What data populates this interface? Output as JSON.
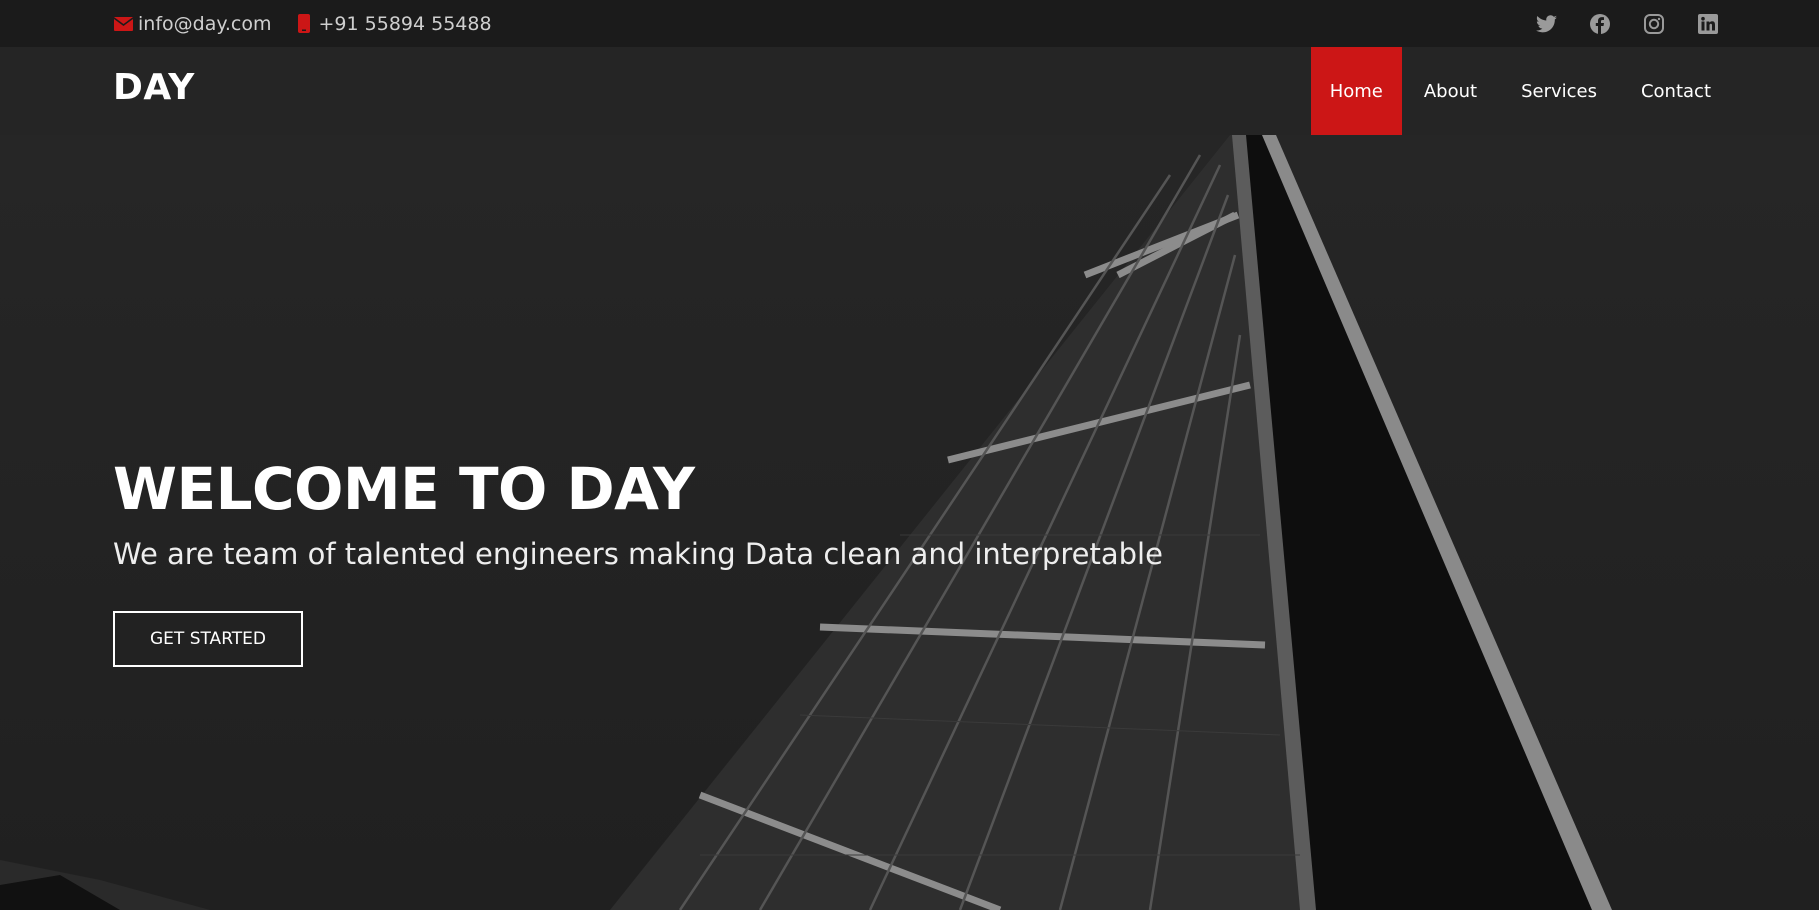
{
  "topbar": {
    "email": "info@day.com",
    "phone": "+91 55894 55488",
    "icons": {
      "email": "envelope-icon",
      "phone": "phone-icon",
      "socials": [
        "twitter-icon",
        "facebook-icon",
        "instagram-icon",
        "linkedin-icon"
      ]
    }
  },
  "header": {
    "logo": "DAY",
    "nav": [
      {
        "label": "Home",
        "active": true
      },
      {
        "label": "About",
        "active": false
      },
      {
        "label": "Services",
        "active": false
      },
      {
        "label": "Contact",
        "active": false
      }
    ]
  },
  "hero": {
    "title": "WELCOME TO DAY",
    "subtitle": "We are team of talented engineers making Data clean and interpretable",
    "cta_label": "GET STARTED"
  },
  "colors": {
    "accent": "#cc1616",
    "topbar_bg": "#1b1b1b",
    "header_bg": "#252525",
    "hero_bg": "#232323"
  }
}
